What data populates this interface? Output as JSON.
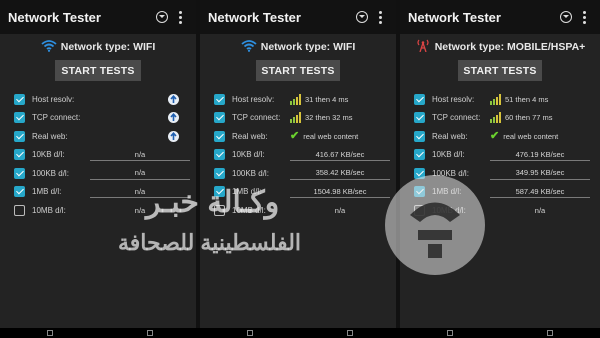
{
  "panels": [
    {
      "title": "Network Tester",
      "network_type": "Network type: WIFI",
      "network_icon": "wifi-icon",
      "start_label": "START TESTS",
      "rows": [
        {
          "label": "Host resolv:",
          "checked": true,
          "result": "",
          "indicator": "arrow"
        },
        {
          "label": "TCP connect:",
          "checked": true,
          "result": "",
          "indicator": "arrow"
        },
        {
          "label": "Real web:",
          "checked": true,
          "result": "",
          "indicator": "arrow"
        },
        {
          "label": "10KB d/l:",
          "checked": true,
          "result": "n/a",
          "indicator": "line"
        },
        {
          "label": "100KB d/l:",
          "checked": true,
          "result": "n/a",
          "indicator": "line"
        },
        {
          "label": "1MB d/l:",
          "checked": true,
          "result": "n/a",
          "indicator": "line"
        },
        {
          "label": "10MB d/l:",
          "checked": false,
          "result": "n/a",
          "indicator": "line"
        }
      ]
    },
    {
      "title": "Network Tester",
      "network_type": "Network type: WIFI",
      "network_icon": "wifi-icon",
      "start_label": "START TESTS",
      "rows": [
        {
          "label": "Host resolv:",
          "checked": true,
          "result": "31 then 4 ms",
          "indicator": "signal"
        },
        {
          "label": "TCP connect:",
          "checked": true,
          "result": "32 then 32 ms",
          "indicator": "signal"
        },
        {
          "label": "Real web:",
          "checked": true,
          "result": "real web content",
          "indicator": "check"
        },
        {
          "label": "10KB d/l:",
          "checked": true,
          "result": "416.67 KB/sec",
          "indicator": "line"
        },
        {
          "label": "100KB d/l:",
          "checked": true,
          "result": "358.42 KB/sec",
          "indicator": "line"
        },
        {
          "label": "1MB d/l:",
          "checked": true,
          "result": "1504.98 KB/sec",
          "indicator": "line"
        },
        {
          "label": "10MB d/l:",
          "checked": false,
          "result": "n/a",
          "indicator": "line"
        }
      ]
    },
    {
      "title": "Network Tester",
      "network_type": "Network type: MOBILE/HSPA+",
      "network_icon": "cell-tower-icon",
      "start_label": "START TESTS",
      "rows": [
        {
          "label": "Host resolv:",
          "checked": true,
          "result": "51 then 4 ms",
          "indicator": "signal"
        },
        {
          "label": "TCP connect:",
          "checked": true,
          "result": "60 then 77 ms",
          "indicator": "signal"
        },
        {
          "label": "Real web:",
          "checked": true,
          "result": "real web content",
          "indicator": "check"
        },
        {
          "label": "10KB d/l:",
          "checked": true,
          "result": "476.19 KB/sec",
          "indicator": "line"
        },
        {
          "label": "100KB d/l:",
          "checked": true,
          "result": "349.95 KB/sec",
          "indicator": "line"
        },
        {
          "label": "1MB d/l:",
          "checked": true,
          "result": "587.49 KB/sec",
          "indicator": "line"
        },
        {
          "label": "10MB d/l:",
          "checked": false,
          "result": "n/a",
          "indicator": "line"
        }
      ]
    }
  ],
  "watermark": {
    "line1": "وكـالة خبـر",
    "line2": "الفلسطينية للصحافة"
  },
  "colors": {
    "checkbox": "#26a7c9",
    "signal_green": "#8dc63f",
    "signal_yellow": "#d7c33b",
    "check_green": "#6ad12e"
  }
}
